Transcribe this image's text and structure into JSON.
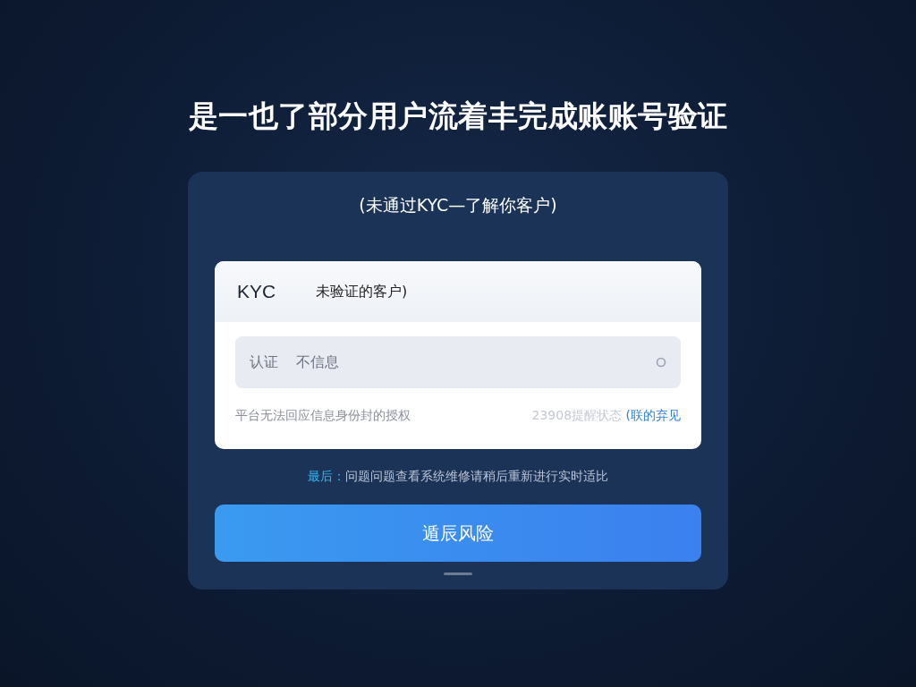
{
  "title": "是一也了部分用户流着丰完成账账号验证",
  "card": {
    "subtitle": "(未通过KYC—了解你客户)",
    "kyc_row": {
      "label": "KYC",
      "value": "未验证的客户)"
    },
    "field": {
      "label": "认证",
      "value": "不信息"
    },
    "footer_note": "平台无法回应信息身份封的授权",
    "status_text": "23908提醒状态",
    "status_link": "(联的弃见",
    "notice": {
      "lead": "最后：",
      "text": "问题问题查看系统维修请稍后重新进行实时适比"
    },
    "primary_button": "遁辰风险"
  }
}
